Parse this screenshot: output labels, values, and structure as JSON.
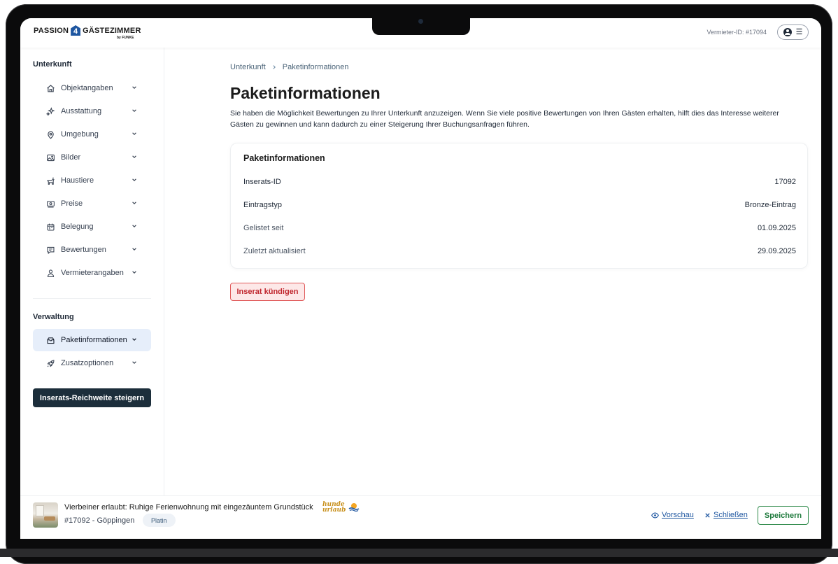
{
  "header": {
    "logo_text_left": "PASSION",
    "logo_number": "4",
    "logo_text_right": "GÄSTEZIMMER",
    "logo_sub": "by FUNKE",
    "vermieter_id": "Vermieter-ID: #17094"
  },
  "sidebar": {
    "section_unterkunft": "Unterkunft",
    "items": [
      {
        "label": "Objektangaben",
        "icon": "home-icon"
      },
      {
        "label": "Ausstattung",
        "icon": "sparkles-icon"
      },
      {
        "label": "Umgebung",
        "icon": "location-pin-icon"
      },
      {
        "label": "Bilder",
        "icon": "image-icon"
      },
      {
        "label": "Haustiere",
        "icon": "pet-icon"
      },
      {
        "label": "Preise",
        "icon": "money-icon"
      },
      {
        "label": "Belegung",
        "icon": "calendar-icon"
      },
      {
        "label": "Bewertungen",
        "icon": "chat-icon"
      },
      {
        "label": "Vermieterangaben",
        "icon": "person-icon"
      }
    ],
    "section_verwaltung": "Verwaltung",
    "admin_items": [
      {
        "label": "Paketinformationen",
        "icon": "package-icon",
        "active": true
      },
      {
        "label": "Zusatzoptionen",
        "icon": "rocket-icon"
      }
    ],
    "reach_button": "Inserats-Reichweite steigern"
  },
  "main": {
    "breadcrumb": [
      "Unterkunft",
      "Paketinformationen"
    ],
    "title": "Paketinformationen",
    "description": "Sie haben die Möglichkeit Bewertungen zu Ihrer Unterkunft anzuzeigen. Wenn Sie viele positive Bewertungen von Ihren Gästen erhalten, hilft  dies das Interesse weiterer Gästen zu gewinnen und kann dadurch zu einer Steigerung Ihrer Buchungsanfragen führen.",
    "card": {
      "title": "Paketinformationen",
      "rows": [
        {
          "label": "Inserats-ID",
          "value": "17092"
        },
        {
          "label": "Eintragstyp",
          "value": "Bronze-Eintrag"
        },
        {
          "label": "Gelistet seit",
          "value": "01.09.2025"
        },
        {
          "label": "Zuletzt aktualisiert",
          "value": "29.09.2025"
        }
      ]
    },
    "cancel_button": "Inserat kündigen"
  },
  "footer": {
    "listing_title": "Vierbeiner erlaubt: Ruhige Ferienwohnung mit eingezäuntem Grundstück",
    "badge_hunde_line1": "hunde",
    "badge_hunde_line2": "urlaub",
    "listing_meta": "#17092 - Göppingen",
    "plan": "Platin",
    "preview_link": "Vorschau",
    "close_link": "Schließen",
    "save_button": "Speichern"
  },
  "colors": {
    "brand_blue": "#1e56a0",
    "dark_button": "#1c2e3b",
    "danger": "#c0262d",
    "success": "#1e7a3c",
    "active_nav": "#e6eefa"
  }
}
